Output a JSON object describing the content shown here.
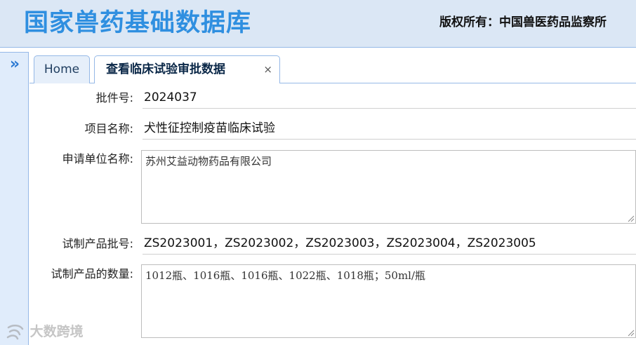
{
  "header": {
    "title": "国家兽药基础数据库",
    "copyright": "版权所有：中国兽医药品监察所"
  },
  "sidebar": {
    "toggle_icon": "double-chevron-right-icon",
    "toggle_glyph": "»"
  },
  "tabs": [
    {
      "label": "Home",
      "active": false
    },
    {
      "label": "查看临床试验审批数据",
      "active": true,
      "closable": true,
      "close_glyph": "×"
    }
  ],
  "form": {
    "approval_no": {
      "label": "批件号:",
      "value": "2024037"
    },
    "project_name": {
      "label": "项目名称:",
      "value": "犬性征控制疫苗临床试验"
    },
    "applicant": {
      "label": "申请单位名称:",
      "value": "苏州艾益动物药品有限公司"
    },
    "batch_no": {
      "label": "试制产品批号:",
      "value": "ZS2023001，ZS2023002，ZS2023003，ZS2023004，ZS2023005"
    },
    "quantity": {
      "label": "试制产品的数量:",
      "value": "1012瓶、1016瓶、1016瓶、1022瓶、1018瓶；50ml/瓶"
    }
  },
  "watermark": {
    "text": "大数跨境"
  },
  "colors": {
    "accent": "#2f8fe0",
    "header_bg": "#dbe7f5",
    "border": "#95b8e7"
  }
}
